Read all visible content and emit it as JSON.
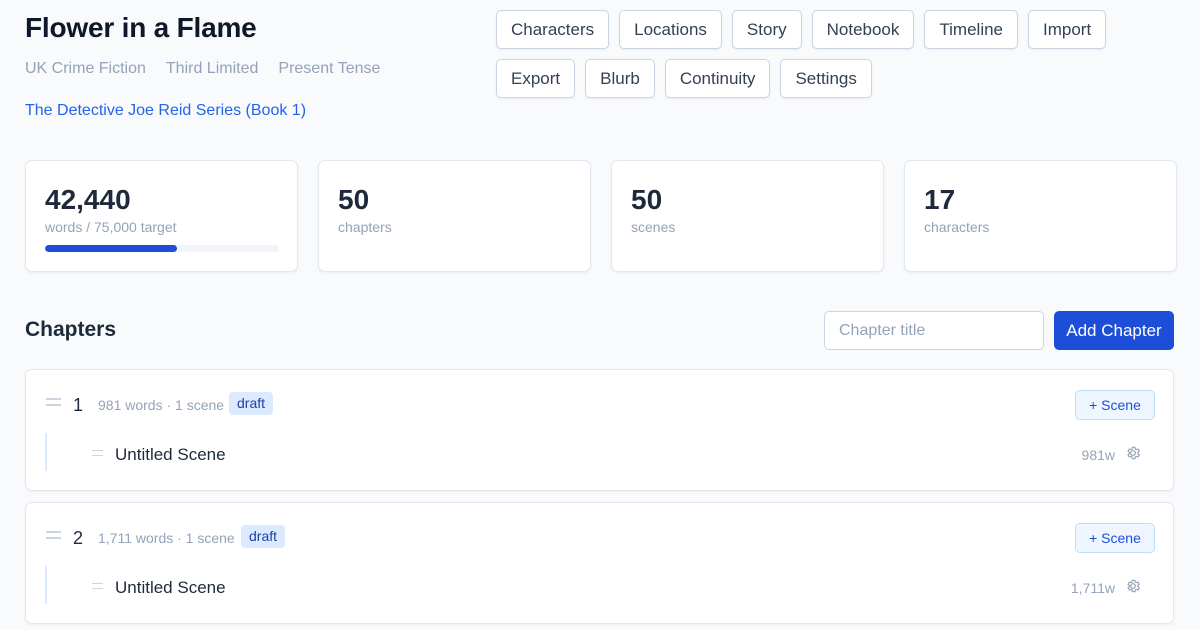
{
  "book": {
    "title": "Flower in a Flame",
    "genre": "UK Crime Fiction",
    "pov": "Third Limited",
    "tense": "Present Tense",
    "series": "The Detective Joe Reid Series (Book 1)"
  },
  "nav": {
    "characters": "Characters",
    "locations": "Locations",
    "story": "Story",
    "notebook": "Notebook",
    "timeline": "Timeline",
    "import": "Import",
    "export": "Export",
    "blurb": "Blurb",
    "continuity": "Continuity",
    "settings": "Settings"
  },
  "stats": {
    "words": {
      "value": "42,440",
      "label": "words / 75,000 target",
      "progress": 0.566
    },
    "chapters": {
      "value": "50",
      "label": "chapters"
    },
    "scenes": {
      "value": "50",
      "label": "scenes"
    },
    "characters": {
      "value": "17",
      "label": "characters"
    }
  },
  "chapters_section": {
    "title": "Chapters",
    "input_placeholder": "Chapter title",
    "add_button": "Add Chapter"
  },
  "chapters": [
    {
      "number": "1",
      "meta": "981 words · 1 scene",
      "status": "draft",
      "add_scene": "+ Scene",
      "scene": {
        "title": "Untitled Scene",
        "words": "981w"
      }
    },
    {
      "number": "2",
      "meta": "1,711 words · 1 scene",
      "status": "draft",
      "add_scene": "+ Scene",
      "scene": {
        "title": "Untitled Scene",
        "words": "1,711w"
      }
    }
  ],
  "colors": {
    "accent": "#1d4ed8",
    "link": "#2563eb",
    "badge_bg": "#dbeafe",
    "muted_text": "#94a3b8"
  },
  "icons": {
    "drag_handle": "drag-handle-icon",
    "scene_settings": "gear-icon"
  }
}
